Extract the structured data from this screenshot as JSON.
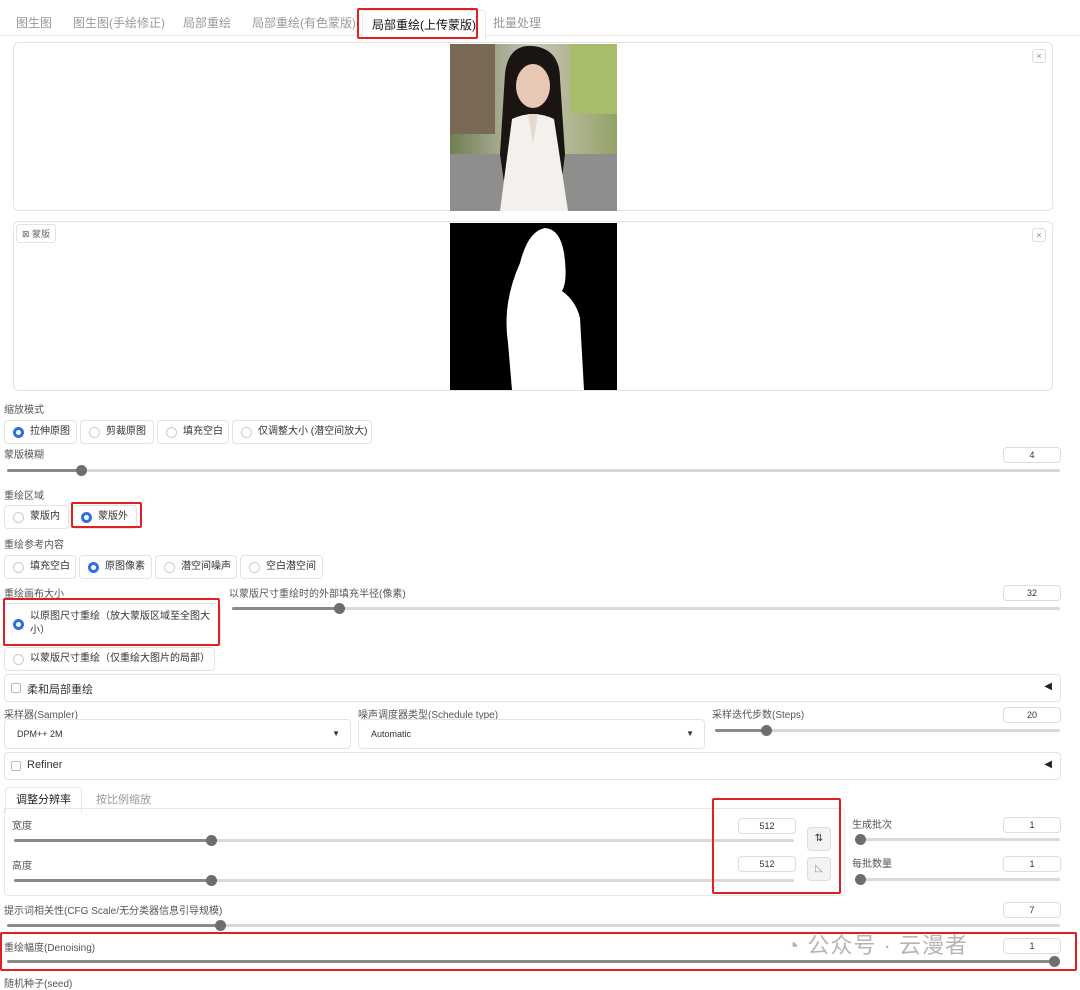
{
  "tabs": [
    "图生图",
    "图生图(手绘修正)",
    "局部重绘",
    "局部重绘(有色蒙版)",
    "局部重绘(上传蒙版)",
    "批量处理"
  ],
  "active_tab": "局部重绘(上传蒙版)",
  "image_panel": {
    "close": "×"
  },
  "mask_panel": {
    "tag": "蒙版",
    "close": "×"
  },
  "resize_mode": {
    "label": "缩放模式",
    "options": [
      "拉伸原图",
      "剪裁原图",
      "填充空白",
      "仅调整大小 (潜空间放大)"
    ],
    "selected": "拉伸原图"
  },
  "mask_blur": {
    "label": "蒙版模糊",
    "value": "4",
    "level": 0.066
  },
  "inpaint_area": {
    "label": "重绘区域",
    "options": [
      "蒙版内",
      "蒙版外"
    ],
    "selected": "蒙版外"
  },
  "masked_content": {
    "label": "重绘参考内容",
    "options": [
      "填充空白",
      "原图像素",
      "潜空间噪声",
      "空白潜空间"
    ],
    "selected": "原图像素"
  },
  "inpaint_canvas": {
    "label": "重绘画布大小",
    "options": [
      "以原图尺寸重绘（放大蒙版区域至全图大小）",
      "以蒙版尺寸重绘（仅重绘大图片的局部）"
    ],
    "selected": "以原图尺寸重绘（放大蒙版区域至全图大小）"
  },
  "padding": {
    "label": "以蒙版尺寸重绘时的外部填充半径(像素)",
    "value": "32",
    "level": 0.125
  },
  "soft_inpaint": {
    "label": "柔和局部重绘",
    "arrow": "◀"
  },
  "sampler": {
    "label": "采样器(Sampler)",
    "value": "DPM++ 2M",
    "caret": "▼"
  },
  "schedule": {
    "label": "噪声调度器类型(Schedule type)",
    "value": "Automatic",
    "caret": "▼"
  },
  "steps": {
    "label": "采样迭代步数(Steps)",
    "value": "20",
    "level": 0.137
  },
  "refiner": {
    "label": "Refiner",
    "arrow": "◀"
  },
  "subtabs": [
    "调整分辨率",
    "按比例缩放"
  ],
  "width": {
    "label": "宽度",
    "value": "512",
    "level": 0.25
  },
  "height": {
    "label": "高度",
    "value": "512",
    "level": 0.25
  },
  "swap_icon": "⇅",
  "ratio_icon": "◺",
  "batch_count": {
    "label": "生成批次",
    "value": "1",
    "level": 0.0
  },
  "batch_size": {
    "label": "每批数量",
    "value": "1",
    "level": 0.0
  },
  "cfg": {
    "label": "提示词相关性(CFG Scale/无分类器信息引导规模)",
    "value": "7",
    "level": 0.2
  },
  "denoising": {
    "label": "重绘幅度(Denoising)",
    "value": "1",
    "level": 1.0
  },
  "seed": {
    "label": "随机种子(seed)"
  },
  "watermark": "公众号 · 云漫者",
  "colors": {
    "accent": "#2f6fde",
    "annotation": "#e02020",
    "slider": "#6e6e6e"
  }
}
